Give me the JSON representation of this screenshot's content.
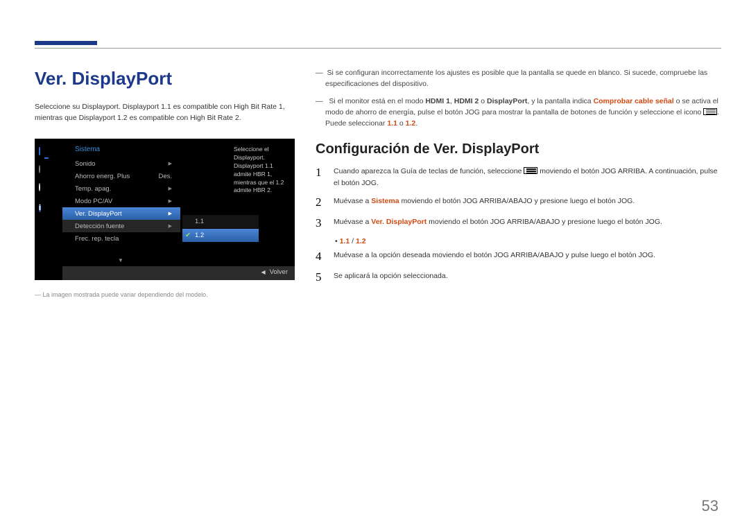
{
  "page_number": "53",
  "header": {},
  "left": {
    "title": "Ver. DisplayPort",
    "intro": "Seleccione su Displayport. Displayport 1.1 es compatible con High Bit Rate 1, mientras que Displayport 1.2 es compatible con High Bit Rate 2.",
    "caption": "La imagen mostrada puede variar dependiendo del modelo."
  },
  "osd": {
    "title": "Sistema",
    "tooltip": "Seleccione el Displayport. Displayport 1.1 admite HBR 1, mientras que el 1.2 admite HBR 2.",
    "rows": [
      {
        "label": "Sonido",
        "value": "",
        "arrow": "▶"
      },
      {
        "label": "Ahorro energ. Plus",
        "value": "Des.",
        "arrow": ""
      },
      {
        "label": "Temp. apag.",
        "value": "",
        "arrow": "▶"
      },
      {
        "label": "Modo PC/AV",
        "value": "",
        "arrow": "▶"
      },
      {
        "label": "Ver. DisplayPort",
        "value": "",
        "arrow": "▶",
        "selected": true
      },
      {
        "label": "Detección fuente",
        "value": "",
        "arrow": "▶"
      },
      {
        "label": "Frec. rep. tecla",
        "value": "",
        "arrow": ""
      }
    ],
    "submenu": {
      "options": [
        "1.1",
        "1.2"
      ],
      "selected": "1.2"
    },
    "footer_back": "Volver",
    "info_glyph": "i"
  },
  "right": {
    "note1_pre": "Si se configuran incorrectamente los ajustes es posible que la pantalla se quede en blanco. Si sucede, compruebe las especificaciones del dispositivo.",
    "note2": {
      "a": "Si el monitor está en el modo ",
      "hdmi1": "HDMI 1",
      "sep1": ", ",
      "hdmi2": "HDMI 2",
      "sep2": " o ",
      "dp": "DisplayPort",
      "b": ", y la pantalla indica ",
      "chk": "Comprobar cable señal",
      "c": " o se activa el modo de ahorro de energía, pulse el botón JOG para mostrar la pantalla de botones de función y seleccione el icono ",
      "d": ". Puede seleccionar ",
      "v1": "1.1",
      "or": " o ",
      "v2": "1.2",
      "end": "."
    },
    "h2": "Configuración de Ver. DisplayPort",
    "steps": {
      "1": {
        "a": "Cuando aparezca la Guía de teclas de función, seleccione ",
        "b": " moviendo el botón JOG ARRIBA. A continuación, pulse el botón JOG."
      },
      "2": {
        "a": "Muévase a ",
        "sistema": "Sistema",
        "b": " moviendo el botón JOG ARRIBA/ABAJO y presione luego el botón JOG."
      },
      "3": {
        "a": "Muévase a ",
        "ver": "Ver. DisplayPort",
        "b": " moviendo el botón JOG ARRIBA/ABAJO y presione luego el botón JOG."
      },
      "3_bullet": {
        "v1": "1.1",
        "sep": " / ",
        "v2": "1.2"
      },
      "4": "Muévase a la opción deseada moviendo el botón JOG ARRIBA/ABAJO y pulse luego el botón JOG.",
      "5": "Se aplicará la opción seleccionada."
    }
  }
}
